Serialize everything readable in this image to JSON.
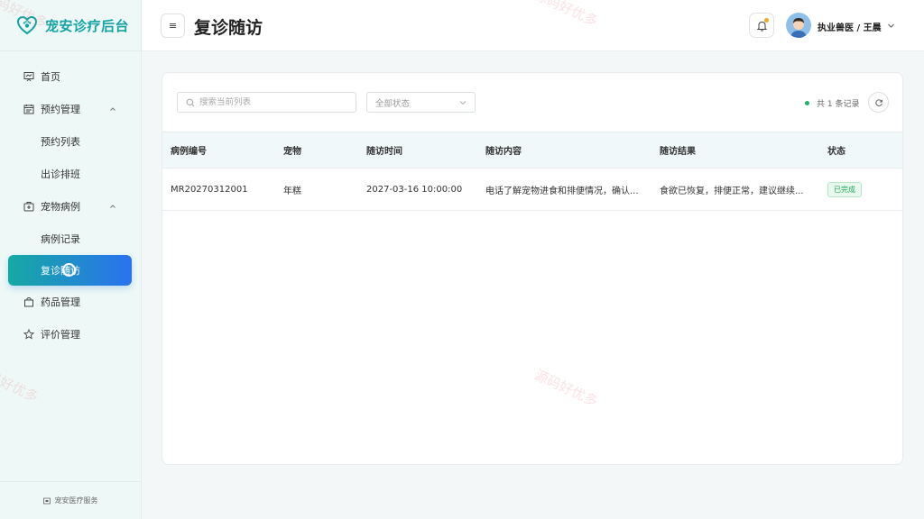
{
  "app": {
    "brand": "宠安诊疗后台",
    "footer": "宠安医疗服务"
  },
  "colors": {
    "brand": "#14a3a3",
    "active_gradient_start": "#16a9a3",
    "active_gradient_end": "#2a72ef",
    "success": "#22a559",
    "notify_dot": "#f5a623"
  },
  "sidebar": {
    "items": [
      {
        "label": "首页",
        "icon": "dashboard-icon"
      },
      {
        "label": "预约管理",
        "icon": "calendar-icon",
        "expanded": true,
        "children": [
          {
            "label": "预约列表"
          },
          {
            "label": "出诊排班"
          }
        ]
      },
      {
        "label": "宠物病例",
        "icon": "medical-case-icon",
        "expanded": true,
        "children": [
          {
            "label": "病例记录"
          },
          {
            "label": "复诊随访",
            "active": true
          }
        ]
      },
      {
        "label": "药品管理",
        "icon": "bag-icon"
      },
      {
        "label": "评价管理",
        "icon": "star-icon"
      }
    ]
  },
  "header": {
    "toggle_icon": "≡",
    "title": "复诊随访",
    "user": "执业兽医 / 王晨"
  },
  "toolbar": {
    "search_placeholder": "搜索当前列表",
    "status_placeholder": "全部状态",
    "record_count": "共 1 条记录"
  },
  "table": {
    "columns": [
      "病例编号",
      "宠物",
      "随访时间",
      "随访内容",
      "随访结果",
      "状态"
    ],
    "rows": [
      [
        "MR20270312001",
        "年糕",
        "2027-03-16 10:00:00",
        "电话了解宠物进食和排便情况，确认...",
        "食欲已恢复，排便正常，建议继续...",
        "已完成"
      ]
    ]
  },
  "watermark": "源码好优多"
}
